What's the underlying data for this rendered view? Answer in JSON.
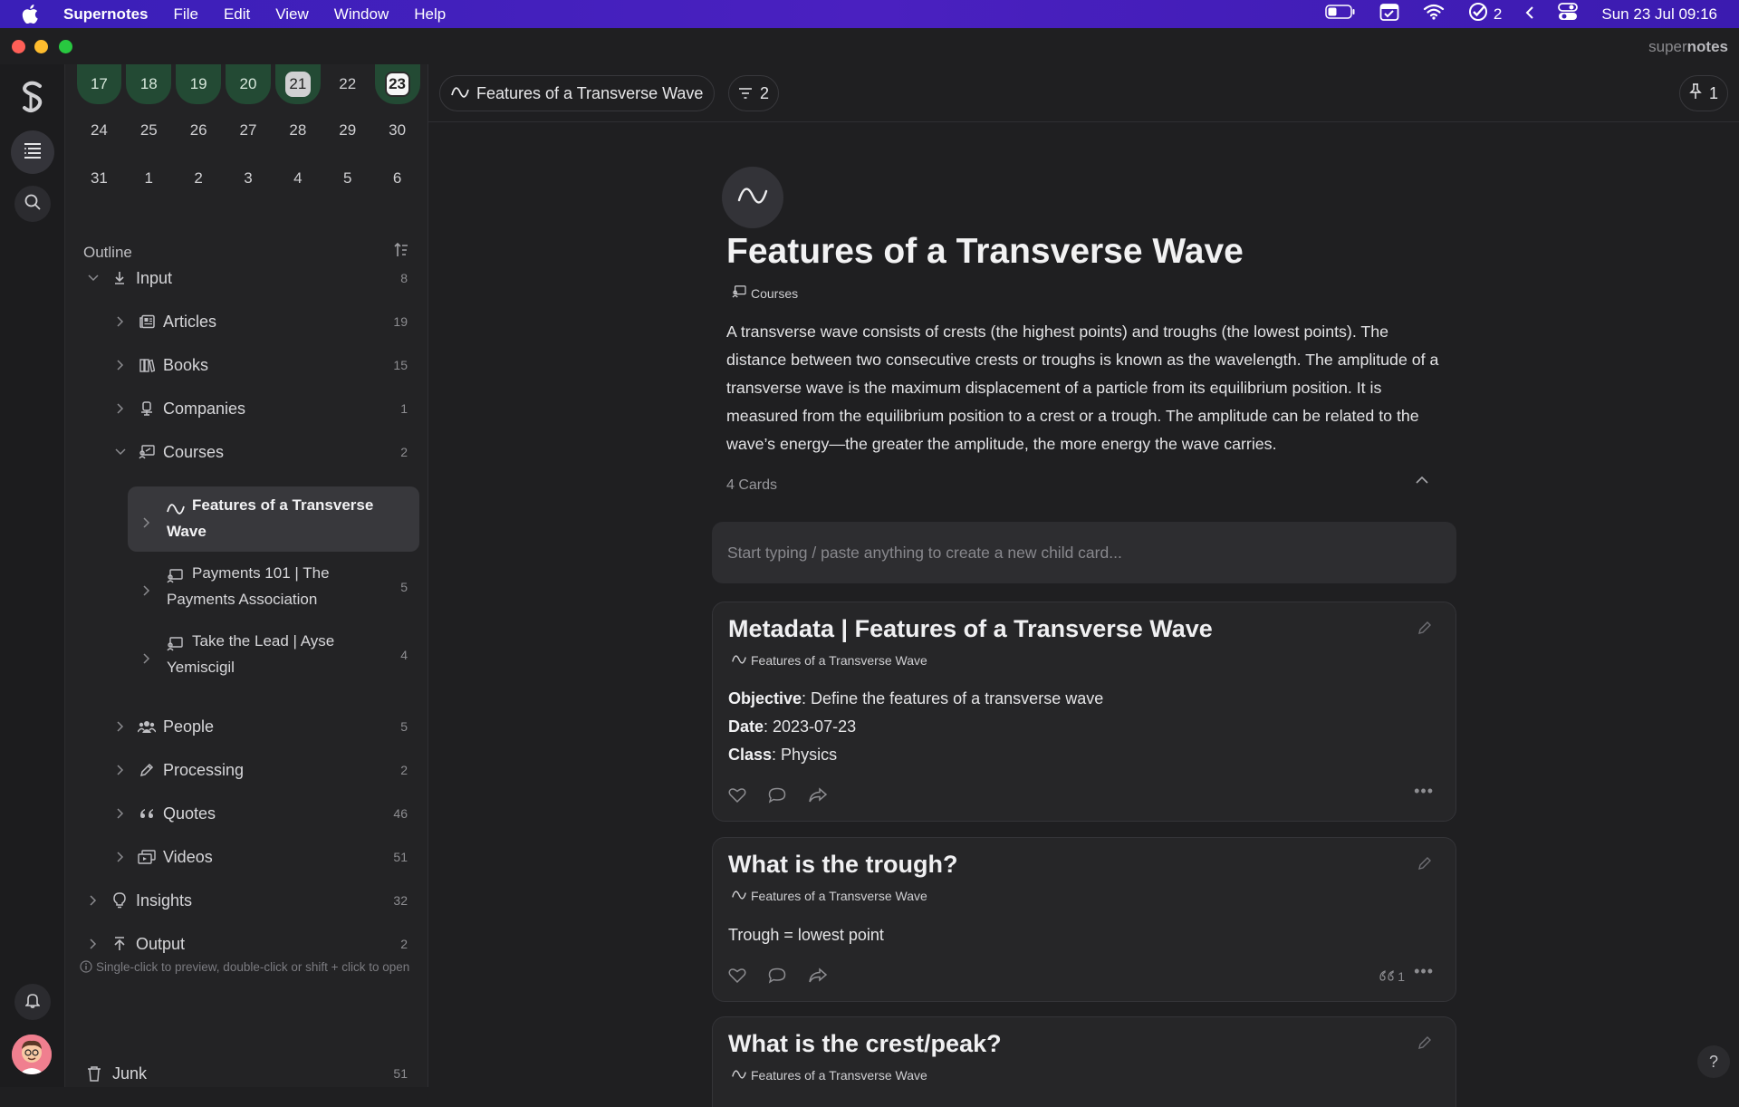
{
  "menubar": {
    "app_name": "Supernotes",
    "menus": [
      "File",
      "Edit",
      "View",
      "Window",
      "Help"
    ],
    "tasks_count": "2",
    "datetime": "Sun 23 Jul  09:16"
  },
  "window": {
    "brand_light": "super",
    "brand_bold": "notes"
  },
  "calendar": {
    "rows": [
      [
        "17",
        "18",
        "19",
        "20",
        "21",
        "22",
        "23"
      ],
      [
        "24",
        "25",
        "26",
        "27",
        "28",
        "29",
        "30"
      ],
      [
        "31",
        "1",
        "2",
        "3",
        "4",
        "5",
        "6"
      ]
    ]
  },
  "sidebar": {
    "outline_label": "Outline",
    "input": {
      "label": "Input",
      "count": "8"
    },
    "articles": {
      "label": "Articles",
      "count": "19"
    },
    "books": {
      "label": "Books",
      "count": "15"
    },
    "companies": {
      "label": "Companies",
      "count": "1"
    },
    "courses": {
      "label": "Courses",
      "count": "2"
    },
    "course_items": [
      {
        "line1": "Features of a Transverse",
        "line2": "Wave",
        "count": ""
      },
      {
        "line1": "Payments 101 | The",
        "line2": "Payments Association",
        "count": "5"
      },
      {
        "line1": "Take the Lead | Ayse",
        "line2": "Yemiscigil",
        "count": "4"
      }
    ],
    "people": {
      "label": "People",
      "count": "5"
    },
    "processing": {
      "label": "Processing",
      "count": "2"
    },
    "quotes": {
      "label": "Quotes",
      "count": "46"
    },
    "videos": {
      "label": "Videos",
      "count": "51"
    },
    "insights": {
      "label": "Insights",
      "count": "32"
    },
    "output": {
      "label": "Output",
      "count": "2"
    },
    "hint": "Single-click to preview, double-click or shift + click to open",
    "junk": {
      "label": "Junk",
      "count": "51"
    }
  },
  "topbar": {
    "breadcrumb": "Features of a Transverse Wave",
    "filter_count": "2",
    "pin_count": "1"
  },
  "page": {
    "title": "Features of a Transverse Wave",
    "parent_tag": "Courses",
    "body": "A transverse wave consists of crests (the highest points) and troughs (the lowest points). The distance between two consecutive crests or troughs is known as the wavelength. The amplitude of a transverse wave is the maximum displacement of a particle from its equilibrium position. It is measured from the equilibrium position to a crest or a trough. The amplitude can be related to the wave’s energy—the greater the amplitude, the more energy the wave carries.",
    "cards_count": "4 Cards",
    "new_card_placeholder": "Start typing / paste anything to create a new child card..."
  },
  "cards": [
    {
      "title": "Metadata | Features of a Transverse Wave",
      "tag": "Features of a Transverse Wave",
      "fields": [
        {
          "key": "Objective",
          "value": ": Define the features of a transverse wave"
        },
        {
          "key": "Date",
          "value": ": 2023-07-23"
        },
        {
          "key": "Class",
          "value": ": Physics"
        }
      ]
    },
    {
      "title": "What is the trough?",
      "tag": "Features of a Transverse Wave",
      "body": "Trough = lowest point",
      "quote_count": "1"
    },
    {
      "title": "What is the crest/peak?",
      "tag": "Features of a Transverse Wave"
    }
  ],
  "help_label": "?",
  "icons": [
    "apple-icon",
    "battery-icon",
    "calendar-check-icon",
    "wifi-icon",
    "tasks-icon",
    "chevron-left-icon",
    "control-center-icon",
    "outline-icon",
    "search-icon",
    "bell-icon",
    "wave-icon",
    "filter-icon",
    "pin-icon",
    "pencil-icon",
    "heart-icon",
    "comment-icon",
    "share-icon",
    "quote-icon",
    "trash-icon"
  ]
}
